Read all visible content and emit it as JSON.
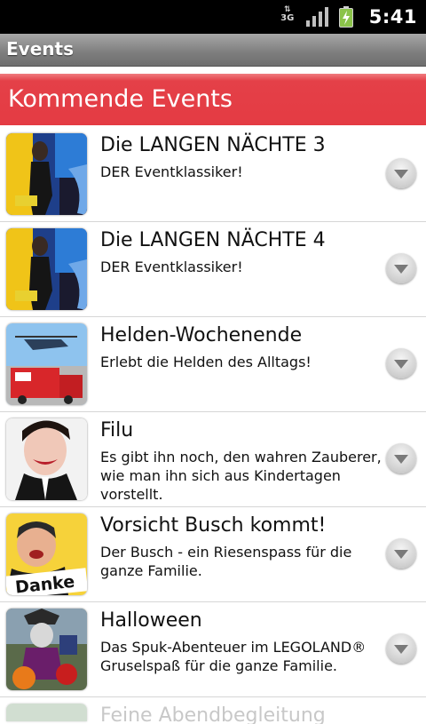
{
  "status_bar": {
    "network_label": "3G",
    "network_icon": "3g-data-icon",
    "signal_icon": "signal-strength-icon",
    "battery_icon": "battery-charging-icon",
    "time": "5:41"
  },
  "title_bar": {
    "title": "Events"
  },
  "section": {
    "label": "Kommende Events",
    "color": "#e43b43"
  },
  "events": [
    {
      "title": "Die LANGEN NÄCHTE 3",
      "description": "DER Eventklassiker!",
      "thumbnail": "singer-on-stage-image"
    },
    {
      "title": "Die LANGEN NÄCHTE 4",
      "description": "DER Eventklassiker!",
      "thumbnail": "singer-on-stage-image"
    },
    {
      "title": "Helden-Wochenende",
      "description": "Erlebt die Helden des Alltags!",
      "thumbnail": "helicopter-fire-truck-image"
    },
    {
      "title": "Filu",
      "description": "Es gibt ihn noch, den wahren Zauberer, wie man ihn sich aus Kindertagen vorstellt.",
      "thumbnail": "magician-portrait-image"
    },
    {
      "title": "Vorsicht Busch kommt!",
      "description": "Der Busch - ein Riesenspass für die ganze Familie.",
      "thumbnail": "comedian-danke-image",
      "thumbnail_text": "Danke"
    },
    {
      "title": "Halloween",
      "description": "Das Spuk-Abenteuer im LEGOLAND® Gruselspaß für die ganze Familie.",
      "thumbnail": "halloween-characters-image"
    }
  ],
  "partial_event": {
    "title": "Feine Abendbegleitung"
  }
}
